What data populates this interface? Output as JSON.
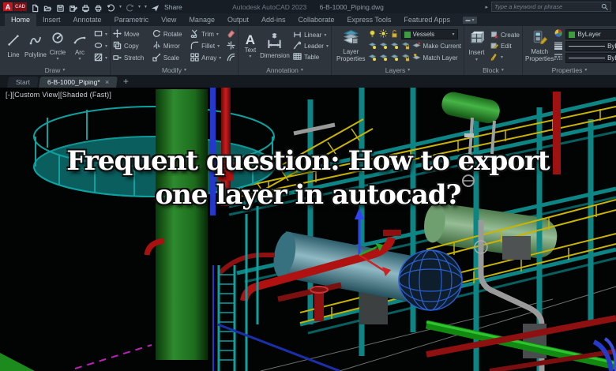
{
  "titlebar": {
    "logo_text": "A",
    "logo_sub": "CAD",
    "share": "Share",
    "app_title": "Autodesk AutoCAD 2023",
    "document_name": "6-B-1000_Piping.dwg",
    "search_placeholder": "Type a keyword or phrase"
  },
  "ribbon_tabs": [
    "Home",
    "Insert",
    "Annotate",
    "Parametric",
    "View",
    "Manage",
    "Output",
    "Add-ins",
    "Collaborate",
    "Express Tools",
    "Featured Apps"
  ],
  "panels": {
    "draw": {
      "label": "Draw",
      "line": "Line",
      "polyline": "Polyline",
      "circle": "Circle",
      "arc": "Arc"
    },
    "modify": {
      "label": "Modify",
      "move": "Move",
      "rotate": "Rotate",
      "trim": "Trim",
      "copy": "Copy",
      "mirror": "Mirror",
      "fillet": "Fillet",
      "stretch": "Stretch",
      "scale": "Scale",
      "array": "Array"
    },
    "annotation": {
      "label": "Annotation",
      "text": "Text",
      "dimension": "Dimension",
      "linear": "Linear",
      "leader": "Leader",
      "table": "Table"
    },
    "layers": {
      "label": "Layers",
      "layer_properties": "Layer Properties",
      "current_layer": "Vessels",
      "make_current": "Make Current",
      "match_layer": "Match Layer",
      "swatch_color": "#3f9b3f"
    },
    "block": {
      "label": "Block",
      "insert": "Insert",
      "create": "Create",
      "edit": "Edit"
    },
    "properties": {
      "label": "Properties",
      "match_properties": "Match Properties",
      "color": "ByLayer",
      "lineweight": "ByLayer",
      "linetype": "ByLayer"
    }
  },
  "file_tabs": {
    "start": "Start",
    "active_doc": "6-B-1000_Piping*",
    "close": "×",
    "new_tab": "+"
  },
  "viewport": {
    "controls": "[-][Custom View][Shaded (Fast)]",
    "headline_line1": "Frequent question: How to export",
    "headline_line2": "one layer in autocad?"
  },
  "scene_colors": {
    "column_green": "#2e8b2e",
    "structure_teal": "#0d8585",
    "railing_yellow": "#c9b500",
    "pipe_red": "#b01212",
    "pipe_blue": "#2438cc",
    "vessel_steel": "#5d93a3",
    "drum_green": "#3fae3f",
    "drum_pale_green": "#7fa97f",
    "magenta_line": "#bb22bb",
    "background": "#020303"
  }
}
